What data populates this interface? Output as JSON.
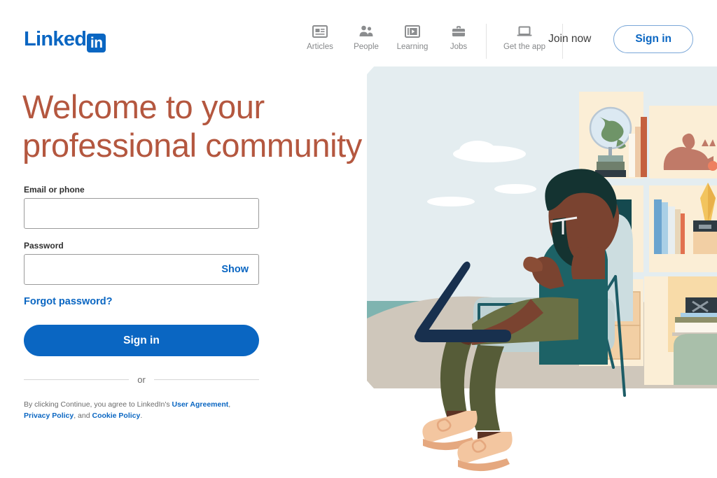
{
  "brand": {
    "name_text": "Linked",
    "name_badge": "in",
    "color": "#0a66c2"
  },
  "header": {
    "nav": [
      {
        "label": "Articles",
        "icon": "articles-icon"
      },
      {
        "label": "People",
        "icon": "people-icon"
      },
      {
        "label": "Learning",
        "icon": "learning-icon"
      },
      {
        "label": "Jobs",
        "icon": "jobs-icon"
      },
      {
        "label": "Get the app",
        "icon": "laptop-icon"
      }
    ],
    "join_now": "Join now",
    "sign_in": "Sign in"
  },
  "hero": {
    "headline": "Welcome to your professional community",
    "headline_color": "#b4573f"
  },
  "form": {
    "email_label": "Email or phone",
    "email_value": "",
    "email_placeholder": "",
    "password_label": "Password",
    "password_value": "",
    "password_placeholder": "",
    "show_label": "Show",
    "forgot_label": "Forgot password?",
    "submit_label": "Sign in",
    "divider_label": "or",
    "legal_prefix": "By clicking Continue, you agree to LinkedIn's ",
    "legal_link_1": "User Agreement",
    "legal_sep_1": ", ",
    "legal_link_2": "Privacy Policy",
    "legal_sep_2": ", and ",
    "legal_link_3": "Cookie Policy",
    "legal_suffix": "."
  },
  "illustration": {
    "alt": "Person with glasses and beard sitting in an armchair using a laptop, beach view behind, bookshelf with globe, cat, binders, lamp and clocks",
    "colors": {
      "sky": "#e4edf0",
      "water": "#7fb4b0",
      "sand": "#f6e4c2",
      "ground": "#cfc7bb",
      "shirt": "#1d6266",
      "pants": "#6a7045",
      "skin": "#7a4330",
      "hair": "#143331",
      "shoe": "#f3c6a0",
      "chair": "#ccdde0",
      "chair_frame": "#1d5c66",
      "shelf": "#fbeed6",
      "cat": "#c07a68",
      "lamp_base": "#e8653a",
      "binder_1": "#a3bda6",
      "binder_2": "#7d9a6a",
      "binder_3": "#15494f"
    }
  }
}
